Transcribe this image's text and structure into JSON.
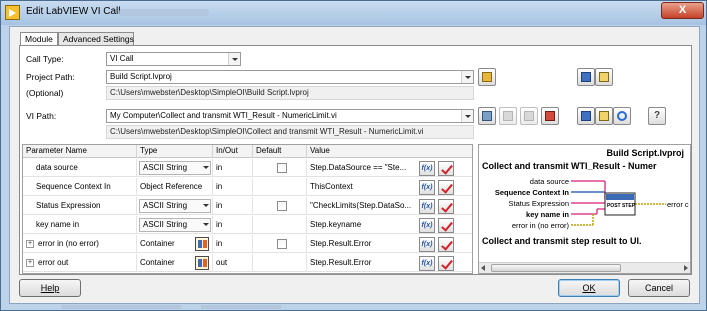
{
  "window": {
    "title": "Edit LabVIEW VI Call",
    "close_label": "X"
  },
  "tabs": [
    {
      "label": "Module",
      "active": true
    },
    {
      "label": "Advanced Settings",
      "active": false
    }
  ],
  "form": {
    "call_type_label": "Call Type:",
    "call_type_value": "VI Call",
    "project_path_label": "Project Path:",
    "project_path_value": "Build Script.lvproj",
    "optional_label": "(Optional)",
    "project_path_resolved": "C:\\Users\\mwebster\\Desktop\\SimpleOI\\Build Script.lvproj",
    "vi_path_label": "VI Path:",
    "vi_path_value": "My Computer\\Collect and transmit WTI_Result - NumericLimit.vi",
    "vi_path_resolved": "C:\\Users\\mwebster\\Desktop\\SimpleOI\\Collect and transmit WTI_Result - NumericLimit.vi"
  },
  "table": {
    "headers": [
      "Parameter Name",
      "Type",
      "In/Out",
      "Default",
      "Value"
    ],
    "rows": [
      {
        "name": "data source",
        "type": "ASCII String",
        "inout": "in",
        "value": "Step.DataSource == \"Ste...",
        "expandable": false,
        "dropdown": true,
        "default": true
      },
      {
        "name": "Sequence Context In",
        "type": "Object Reference",
        "inout": "in",
        "value": "ThisContext",
        "expandable": false,
        "dropdown": false,
        "default": false
      },
      {
        "name": "Status Expression",
        "type": "ASCII String",
        "inout": "in",
        "value": "\"CheckLimits(Step.DataSo...",
        "expandable": false,
        "dropdown": true,
        "default": true
      },
      {
        "name": "key name in",
        "type": "ASCII String",
        "inout": "in",
        "value": "Step.keyname",
        "expandable": false,
        "dropdown": true,
        "default": false
      },
      {
        "name": "error in (no error)",
        "type": "Container",
        "inout": "in",
        "value": "Step.Result.Error",
        "expandable": true,
        "dropdown": false,
        "default": true
      },
      {
        "name": "error out",
        "type": "Container",
        "inout": "out",
        "value": "Step.Result.Error",
        "expandable": true,
        "dropdown": false,
        "default": false
      }
    ]
  },
  "preview": {
    "project": "Build Script.lvproj",
    "vi_name": "Collect and transmit WTI_Result - Numer",
    "terminals_in": [
      "data source",
      "Sequence Context In",
      "Status Expression",
      "key name in",
      "error in (no error)"
    ],
    "terminal_out": "error c",
    "icon_text": "POST STEP",
    "description": "Collect and transmit step result to UI."
  },
  "buttons": {
    "help": "Help",
    "ok": "OK",
    "cancel": "Cancel"
  },
  "colors": {
    "accent": "#3c7fb1",
    "check_red": "#d3202a",
    "wire_pink": "#e0408f",
    "wire_gold": "#c4a000"
  }
}
